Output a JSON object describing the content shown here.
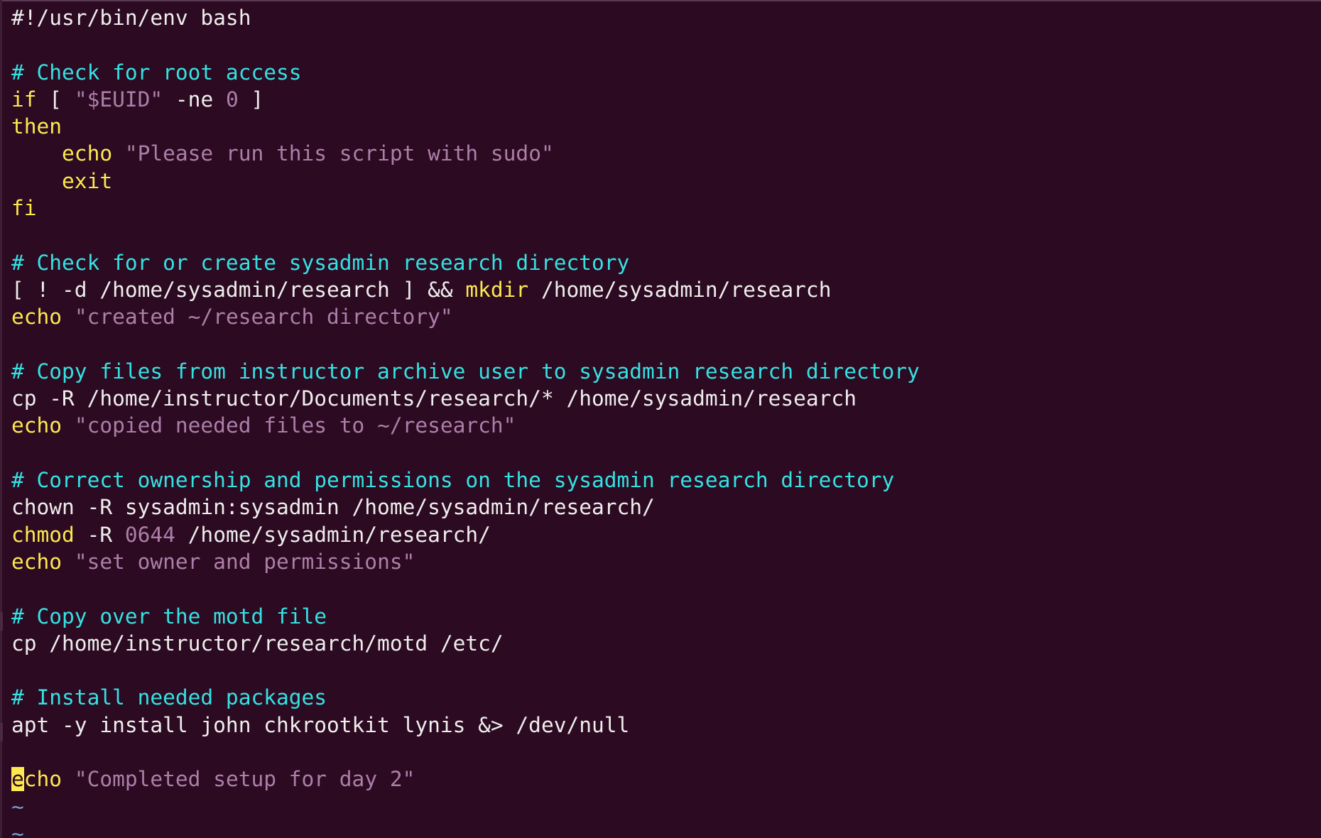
{
  "colors": {
    "background": "#2c0a22",
    "default": "#eeeeec",
    "comment": "#34e2e2",
    "keyword": "#fce94f",
    "string": "#ad7fa8",
    "number": "#ad7fa8",
    "tilde": "#729fcf",
    "cursor": "#fce94f"
  },
  "lines": [
    [
      {
        "text": "#!/usr/bin/env bash",
        "type": "default"
      }
    ],
    [],
    [
      {
        "text": "# Check for root access",
        "type": "comment"
      }
    ],
    [
      {
        "text": "if",
        "type": "keyword"
      },
      {
        "text": " [ ",
        "type": "default"
      },
      {
        "text": "\"$EUID\"",
        "type": "string"
      },
      {
        "text": " -ne ",
        "type": "default"
      },
      {
        "text": "0",
        "type": "number"
      },
      {
        "text": " ]",
        "type": "default"
      }
    ],
    [
      {
        "text": "then",
        "type": "keyword"
      }
    ],
    [
      {
        "text": "    ",
        "type": "default"
      },
      {
        "text": "echo",
        "type": "keyword"
      },
      {
        "text": " ",
        "type": "default"
      },
      {
        "text": "\"Please run this script with sudo\"",
        "type": "string"
      }
    ],
    [
      {
        "text": "    ",
        "type": "default"
      },
      {
        "text": "exit",
        "type": "keyword"
      }
    ],
    [
      {
        "text": "fi",
        "type": "keyword"
      }
    ],
    [],
    [
      {
        "text": "# Check for or create sysadmin research directory",
        "type": "comment"
      }
    ],
    [
      {
        "text": "[ ! -d /home/sysadmin/research ] && ",
        "type": "default"
      },
      {
        "text": "mkdir",
        "type": "keyword"
      },
      {
        "text": " /home/sysadmin/research",
        "type": "default"
      }
    ],
    [
      {
        "text": "echo",
        "type": "keyword"
      },
      {
        "text": " ",
        "type": "default"
      },
      {
        "text": "\"created ~/research directory\"",
        "type": "string"
      }
    ],
    [],
    [
      {
        "text": "# Copy files from instructor archive user to sysadmin research directory",
        "type": "comment"
      }
    ],
    [
      {
        "text": "cp -R /home/instructor/Documents/research/* /home/sysadmin/research",
        "type": "default"
      }
    ],
    [
      {
        "text": "echo",
        "type": "keyword"
      },
      {
        "text": " ",
        "type": "default"
      },
      {
        "text": "\"copied needed files to ~/research\"",
        "type": "string"
      }
    ],
    [],
    [
      {
        "text": "# Correct ownership and permissions on the sysadmin research directory",
        "type": "comment"
      }
    ],
    [
      {
        "text": "chown -R sysadmin:sysadmin /home/sysadmin/research/",
        "type": "default"
      }
    ],
    [
      {
        "text": "chmod",
        "type": "keyword"
      },
      {
        "text": " -R ",
        "type": "default"
      },
      {
        "text": "0644",
        "type": "number"
      },
      {
        "text": " /home/sysadmin/research/",
        "type": "default"
      }
    ],
    [
      {
        "text": "echo",
        "type": "keyword"
      },
      {
        "text": " ",
        "type": "default"
      },
      {
        "text": "\"set owner and permissions\"",
        "type": "string"
      }
    ],
    [],
    [
      {
        "text": "# Copy over the motd file",
        "type": "comment"
      }
    ],
    [
      {
        "text": "cp /home/instructor/research/motd /etc/",
        "type": "default"
      }
    ],
    [],
    [
      {
        "text": "# Install needed packages",
        "type": "comment"
      }
    ],
    [
      {
        "text": "apt -y install john chkrootkit lynis &> /dev/null",
        "type": "default"
      }
    ],
    [],
    [
      {
        "text": "e",
        "type": "cursor"
      },
      {
        "text": "cho",
        "type": "keyword"
      },
      {
        "text": " ",
        "type": "default"
      },
      {
        "text": "\"Completed setup for day 2\"",
        "type": "string"
      }
    ],
    [
      {
        "text": "~",
        "type": "tilde"
      }
    ],
    [
      {
        "text": "~",
        "type": "tilde"
      }
    ]
  ]
}
